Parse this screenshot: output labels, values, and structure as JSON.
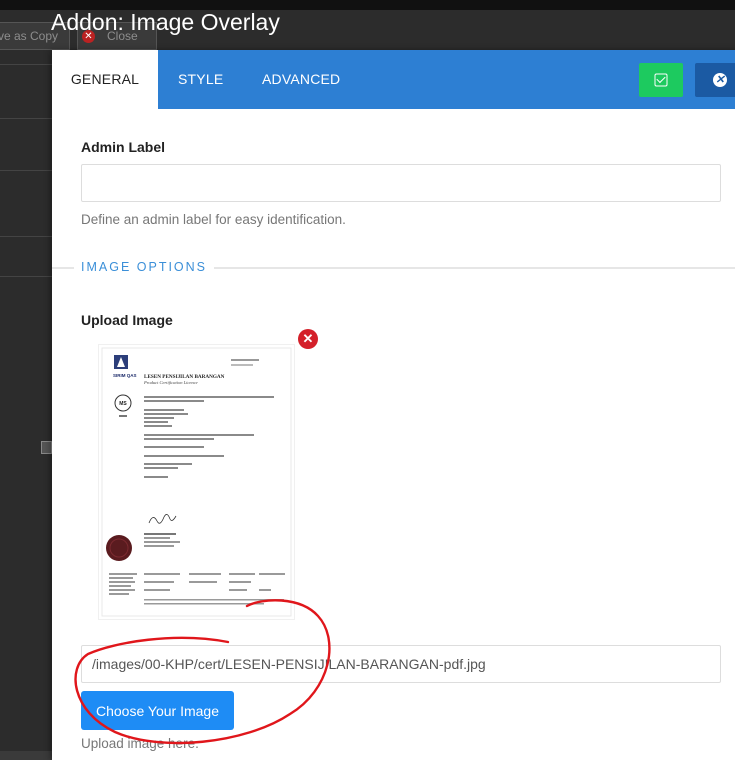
{
  "background": {
    "save_as_copy_label": "ve as Copy",
    "close_label": "Close",
    "close_icon_glyph": "✕"
  },
  "modal": {
    "title": "Addon: Image Overlay",
    "tabs": [
      {
        "label": "GENERAL",
        "active": true
      },
      {
        "label": "STYLE",
        "active": false
      },
      {
        "label": "ADVANCED",
        "active": false
      }
    ],
    "apply_icon": "check-square-icon",
    "cancel_icon": "close-circle-icon",
    "cancel_glyph": "✕"
  },
  "form": {
    "admin_label": {
      "label": "Admin Label",
      "value": "",
      "help": "Define an admin label for easy identification."
    },
    "image_section_title": "IMAGE OPTIONS",
    "upload": {
      "label": "Upload Image",
      "remove_glyph": "✕",
      "path_value": "/images/00-KHP/cert/LESEN-PENSIJILAN-BARANGAN-pdf.jpg",
      "choose_button": "Choose Your Image",
      "help": "Upload image here."
    }
  },
  "preview": {
    "logo_text": "SIRIM QAS",
    "heading": "LESEN PENSIJILAN BARANGAN",
    "subheading": "Product Certification Licence",
    "signer": "Mohd Fadzil Ahmad",
    "ms_mark": "MS"
  },
  "colors": {
    "tab_bar": "#2d7fd3",
    "apply": "#1dca5f",
    "cancel": "#1b5aa3",
    "choose": "#1e8cf5",
    "section_title": "#3b8fd8",
    "annotation": "#e0161b"
  }
}
